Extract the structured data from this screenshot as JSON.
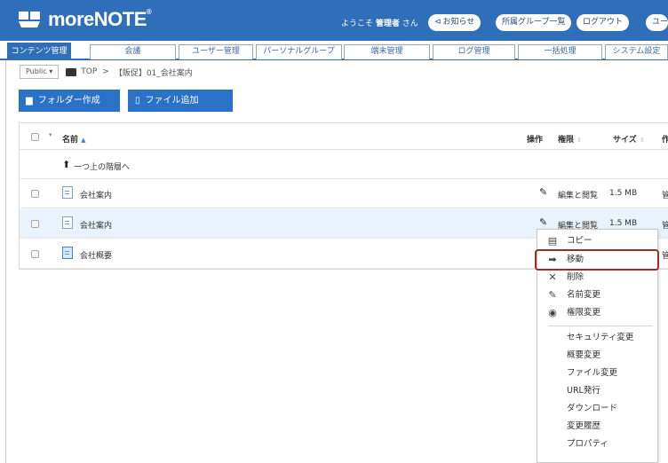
{
  "brand": {
    "name": "moreNOTE",
    "reg": "®"
  },
  "header": {
    "welcome_prefix": "ようこそ",
    "user_name": "管理者",
    "welcome_suffix": "さん",
    "buttons": [
      {
        "label": "お知らせ",
        "icon": "announce-icon"
      },
      {
        "label": "所属グループ一覧"
      },
      {
        "label": "ログアウト"
      },
      {
        "label": "ユー"
      }
    ]
  },
  "tabs": [
    {
      "label": "コンテンツ管理",
      "active": true
    },
    {
      "label": "会議"
    },
    {
      "label": "ユーザー管理"
    },
    {
      "label": "パーソナルグループ"
    },
    {
      "label": "端末管理"
    },
    {
      "label": "ログ管理"
    },
    {
      "label": "一括処理"
    },
    {
      "label": "システム設定"
    }
  ],
  "breadcrumb": {
    "scope_select": "Public",
    "root": "TOP",
    "separator": ">",
    "current": "【販促】01_会社案内"
  },
  "actions": {
    "create_folder": "フォルダー作成",
    "add_file": "ファイル追加"
  },
  "table": {
    "columns": {
      "name": "名前",
      "ops": "操作",
      "perm": "権限",
      "size": "サイズ",
      "author": "作"
    },
    "up_level": "一つ上の階層へ",
    "rows": [
      {
        "name": "会社案内",
        "perm": "編集と閲覧",
        "size": "1.5 MB",
        "author": "管"
      },
      {
        "name": "会社案内",
        "perm": "編集と閲覧",
        "size": "1.5 MB",
        "author": "管"
      },
      {
        "name": "会社概要",
        "author": "管"
      }
    ]
  },
  "context_menu": {
    "items": [
      {
        "label": "コピー",
        "icon": "copy-icon"
      },
      {
        "label": "移動",
        "icon": "move-arrow-icon"
      },
      {
        "label": "削除",
        "icon": "delete-x-icon"
      },
      {
        "label": "名前変更",
        "icon": "rename-icon"
      },
      {
        "label": "権限変更",
        "icon": "permission-icon"
      },
      {
        "label": "セキュリティ変更"
      },
      {
        "label": "概要変更"
      },
      {
        "label": "ファイル変更"
      },
      {
        "label": "URL発行"
      },
      {
        "label": "ダウンロード"
      },
      {
        "label": "変更履歴"
      },
      {
        "label": "プロパティ"
      }
    ]
  },
  "colors": {
    "header": "#2f6fb9",
    "button": "#2a72c8",
    "selected_row": "#eaf3fb",
    "highlight": "#9b2c2c"
  }
}
